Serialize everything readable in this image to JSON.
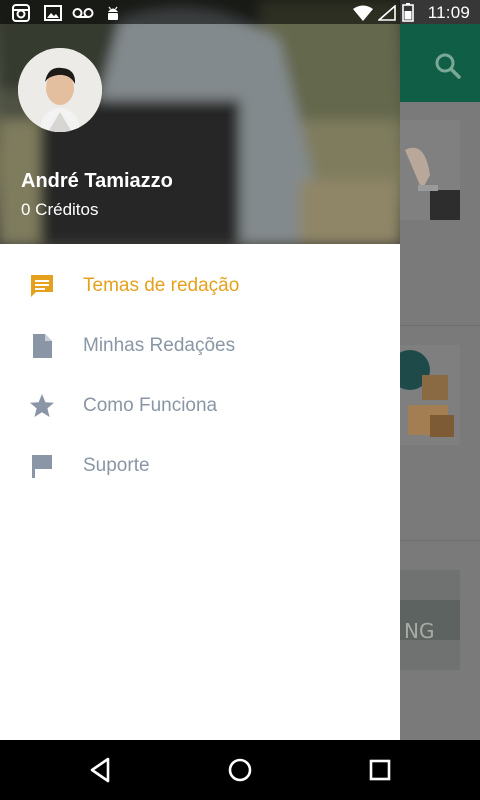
{
  "status_bar": {
    "time": "11:09",
    "left_icons": [
      "instagram-icon",
      "image-icon",
      "voicemail-icon",
      "android-icon"
    ],
    "right_icons": [
      "wifi-icon",
      "signal-icon",
      "battery-icon"
    ]
  },
  "app": {
    "toolbar_icon": "search-icon",
    "accent_color": "#0f5e45"
  },
  "drawer": {
    "header": {
      "user_name": "André Tamiazzo",
      "credits": "0 Créditos"
    },
    "menu": [
      {
        "label": "Temas de redação",
        "icon": "comment-icon",
        "active": true
      },
      {
        "label": "Minhas Redações",
        "icon": "document-icon",
        "active": false
      },
      {
        "label": "Como Funciona",
        "icon": "star-icon",
        "active": false
      },
      {
        "label": "Suporte",
        "icon": "flag-icon",
        "active": false
      }
    ],
    "active_color": "#e5a11d",
    "inactive_color": "#8a96a6"
  },
  "nav_bar": {
    "buttons": [
      "back-icon",
      "home-icon",
      "recents-icon"
    ]
  }
}
